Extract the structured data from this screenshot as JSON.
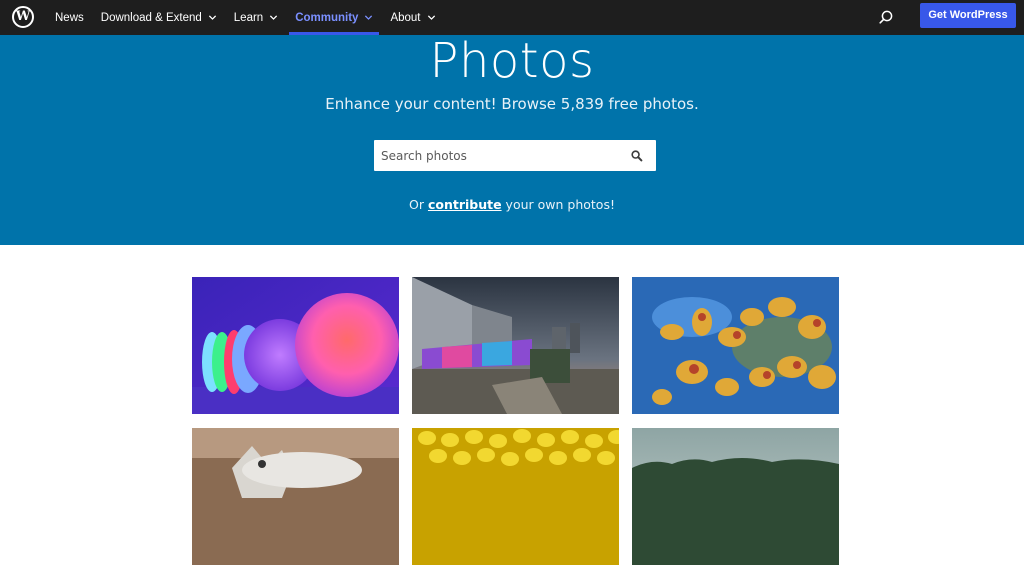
{
  "nav": {
    "logo": "W",
    "items": [
      {
        "label": "News",
        "has_menu": false
      },
      {
        "label": "Download & Extend",
        "has_menu": true
      },
      {
        "label": "Learn",
        "has_menu": true
      },
      {
        "label": "Community",
        "has_menu": true,
        "active": true
      },
      {
        "label": "About",
        "has_menu": true
      }
    ],
    "search_icon": "search-icon",
    "cta_label": "Get WordPress"
  },
  "hero": {
    "title": "Photos",
    "subtitle": "Enhance your content! Browse 5,839 free photos.",
    "search_placeholder": "Search photos",
    "contrib_prefix": "Or ",
    "contrib_link": "contribute",
    "contrib_suffix": " your own photos!"
  },
  "colors": {
    "nav_bg": "#1e1e1e",
    "hero_bg": "#0073aa",
    "accent": "#3858e9",
    "active_nav": "#7b90ff"
  },
  "photos": [
    {
      "subject": "glowing light spheres"
    },
    {
      "subject": "apartment buildings with graffiti wall"
    },
    {
      "subject": "koi fish swarm"
    },
    {
      "subject": "goat"
    },
    {
      "subject": "corn kernels"
    },
    {
      "subject": "sky over treeline"
    }
  ]
}
